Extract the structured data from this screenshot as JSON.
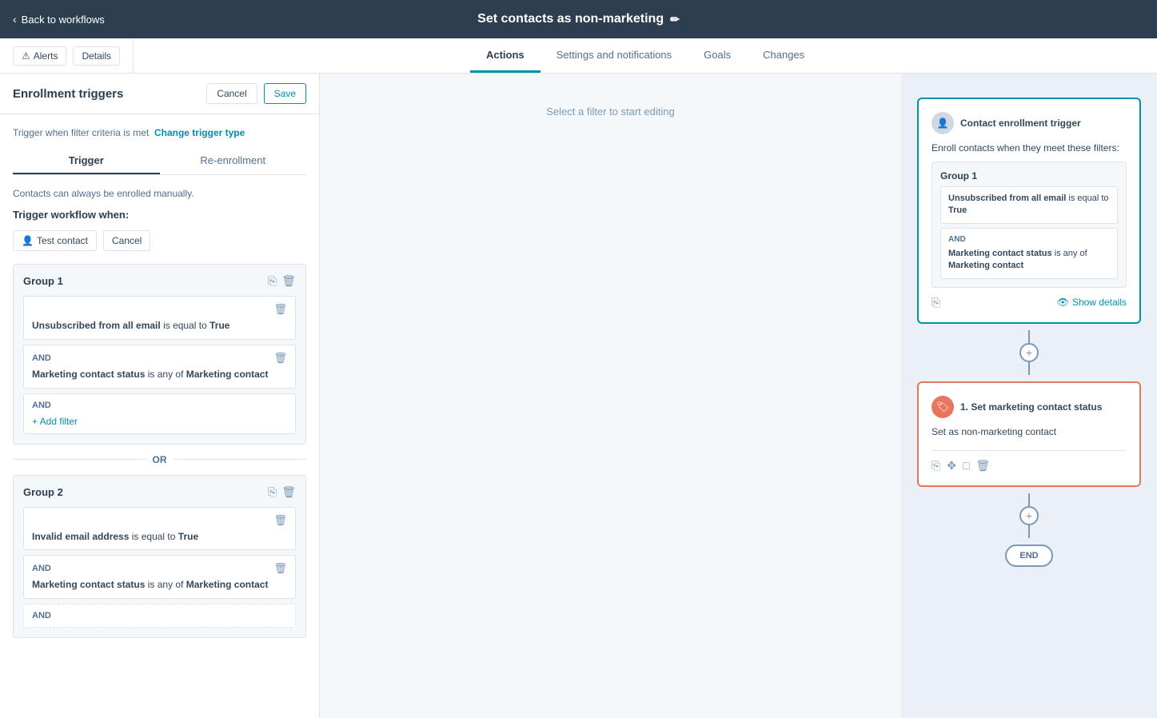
{
  "topNav": {
    "backLabel": "Back to workflows",
    "title": "Set contacts as non-marketing",
    "editIconLabel": "✏"
  },
  "tabsBar": {
    "alertsLabel": "Alerts",
    "detailsLabel": "Details",
    "tabs": [
      {
        "id": "actions",
        "label": "Actions",
        "active": true
      },
      {
        "id": "settings",
        "label": "Settings and notifications",
        "active": false
      },
      {
        "id": "goals",
        "label": "Goals",
        "active": false
      },
      {
        "id": "changes",
        "label": "Changes",
        "active": false
      }
    ]
  },
  "leftPanel": {
    "title": "Enrollment triggers",
    "cancelLabel": "Cancel",
    "saveLabel": "Save",
    "triggerInfo": "Trigger when filter criteria is met",
    "changeTriggerLabel": "Change trigger type",
    "subTabs": [
      {
        "label": "Trigger",
        "active": true
      },
      {
        "label": "Re-enrollment",
        "active": false
      }
    ],
    "enrolledNote": "Contacts can always be enrolled manually.",
    "triggerWhen": "Trigger workflow when:",
    "testContactLabel": "Test contact",
    "cancelSmallLabel": "Cancel",
    "groups": [
      {
        "id": "group1",
        "label": "Group 1",
        "filters": [
          {
            "type": "first",
            "text": "Unsubscribed from all email",
            "operator": "is equal to",
            "value": "True"
          },
          {
            "type": "and",
            "andLabel": "AND",
            "text": "Marketing contact status",
            "operator": "is any of",
            "value": "Marketing contact"
          }
        ],
        "addFilterLabel": "+ Add filter",
        "andLabel": "AND"
      },
      {
        "id": "group2",
        "label": "Group 2",
        "filters": [
          {
            "type": "first",
            "text": "Invalid email address",
            "operator": "is equal to",
            "value": "True"
          },
          {
            "type": "and",
            "andLabel": "AND",
            "text": "Marketing contact status",
            "operator": "is any of",
            "value": "Marketing contact"
          }
        ],
        "andLabel": "AND"
      }
    ],
    "orLabel": "OR"
  },
  "middlePanel": {
    "placeholderText": "Select a filter to start editing"
  },
  "rightPanel": {
    "triggerCard": {
      "avatarLabel": "👤",
      "title": "Contact enrollment trigger",
      "enrollText": "Enroll contacts when they meet these filters:",
      "groupLabel": "Group 1",
      "filter1Text": "Unsubscribed from all email",
      "filter1Operator": "is equal to",
      "filter1Value": "True",
      "andLabel": "AND",
      "filter2Text": "Marketing contact status",
      "filter2Operator": "is any of",
      "filter2Value": "Marketing contact",
      "showDetailsLabel": "Show details",
      "eyeIconLabel": "👁"
    },
    "actionCard": {
      "iconLabel": "🏷",
      "stepNumber": "1.",
      "title": "Set marketing contact status",
      "description": "Set as non-marketing contact",
      "footerIcons": [
        "copy",
        "move",
        "template",
        "delete"
      ]
    },
    "endLabel": "END",
    "plusLabel": "+"
  }
}
